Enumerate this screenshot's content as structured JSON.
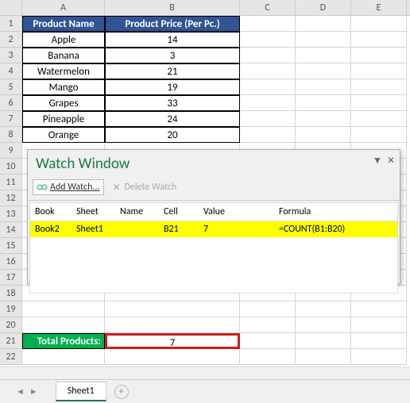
{
  "columns": [
    "A",
    "B",
    "C",
    "D",
    "E"
  ],
  "headers": {
    "a": "Product Name",
    "b": "Product Price (Per Pc.)"
  },
  "rows": [
    {
      "a": "Apple",
      "b": "14"
    },
    {
      "a": "Banana",
      "b": "3"
    },
    {
      "a": "Watermelon",
      "b": "21"
    },
    {
      "a": "Mango",
      "b": "19"
    },
    {
      "a": "Grapes",
      "b": "33"
    },
    {
      "a": "Pineapple",
      "b": "24"
    },
    {
      "a": "Orange",
      "b": "20"
    }
  ],
  "total": {
    "label": "Total Products:",
    "value": "7"
  },
  "watch": {
    "title": "Watch Window",
    "add": "Add Watch...",
    "del": "Delete Watch",
    "cols": {
      "book": "Book",
      "sheet": "Sheet",
      "name": "Name",
      "cell": "Cell",
      "value": "Value",
      "formula": "Formula"
    },
    "row": {
      "book": "Book2",
      "sheet": "Sheet1",
      "name": "",
      "cell": "B21",
      "value": "7",
      "formula": "=COUNT(B1:B20)"
    }
  },
  "tab": "Sheet1"
}
